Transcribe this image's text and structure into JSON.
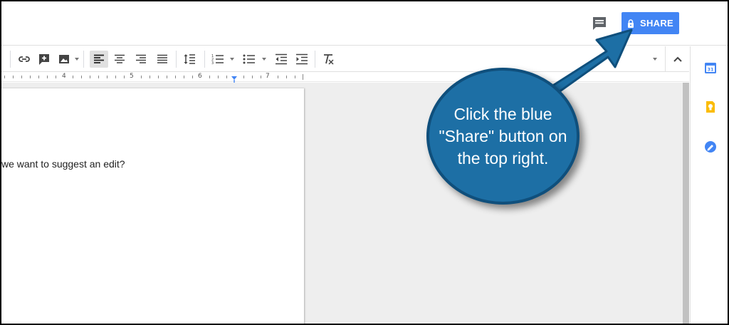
{
  "header": {
    "share_label": "SHARE",
    "comment_icon": "comment-icon",
    "lock_icon": "lock-icon",
    "share_color": "#4285f4"
  },
  "toolbar": {
    "icons": [
      "insert-link-icon",
      "insert-comment-icon",
      "insert-image-icon",
      "align-left-icon",
      "align-center-icon",
      "align-right-icon",
      "align-justify-icon",
      "line-spacing-icon",
      "numbered-list-icon",
      "bulleted-list-icon",
      "decrease-indent-icon",
      "increase-indent-icon",
      "clear-formatting-icon",
      "collapse-icon"
    ],
    "active": "align-left-icon"
  },
  "ruler": {
    "numbers": [
      "4",
      "5",
      "6",
      "7"
    ]
  },
  "document": {
    "visible_text": "we want to suggest an edit?"
  },
  "sidepanel": {
    "icons": [
      "calendar-icon",
      "keep-icon",
      "tasks-icon"
    ],
    "calendar_label": "31"
  },
  "callout": {
    "text": "Click the blue\n\"Share\" button on\nthe top right.",
    "color": "#1d6fa5"
  }
}
